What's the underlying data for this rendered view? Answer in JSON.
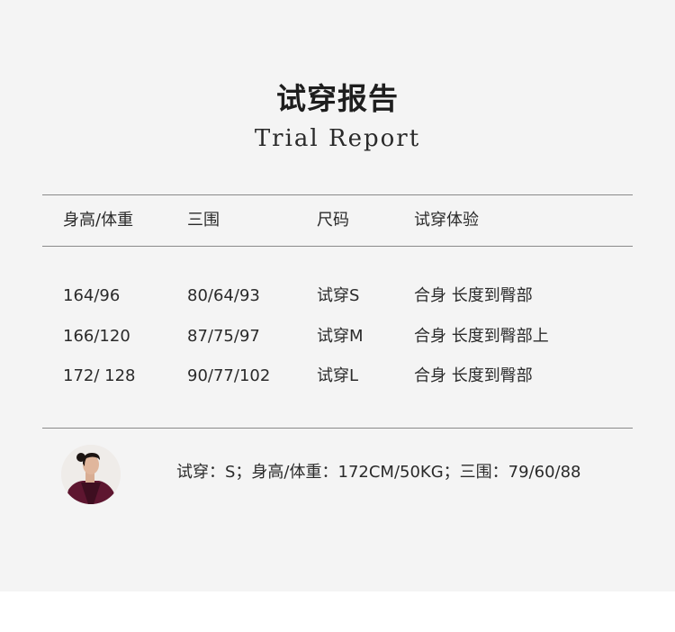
{
  "title": {
    "cn": "试穿报告",
    "en": "Trial Report"
  },
  "table": {
    "headers": [
      "身高/体重",
      "三围",
      "尺码",
      "试穿体验"
    ],
    "rows": [
      [
        "164/96",
        "80/64/93",
        "试穿S",
        "合身 长度到臀部"
      ],
      [
        "166/120",
        "87/75/97",
        "试穿M",
        "合身 长度到臀部上"
      ],
      [
        "172/ 128",
        "90/77/102",
        "试穿L",
        "合身 长度到臀部"
      ]
    ]
  },
  "model": {
    "avatar_icon": "model-portrait-icon",
    "note": "试穿：S；身高/体重：172CM/50KG；三围：79/60/88"
  },
  "colors": {
    "panel_background": "#f4f4f4",
    "page_background": "#ffffff",
    "divider": "#8a8a8a",
    "text": "#2a2a2a"
  }
}
